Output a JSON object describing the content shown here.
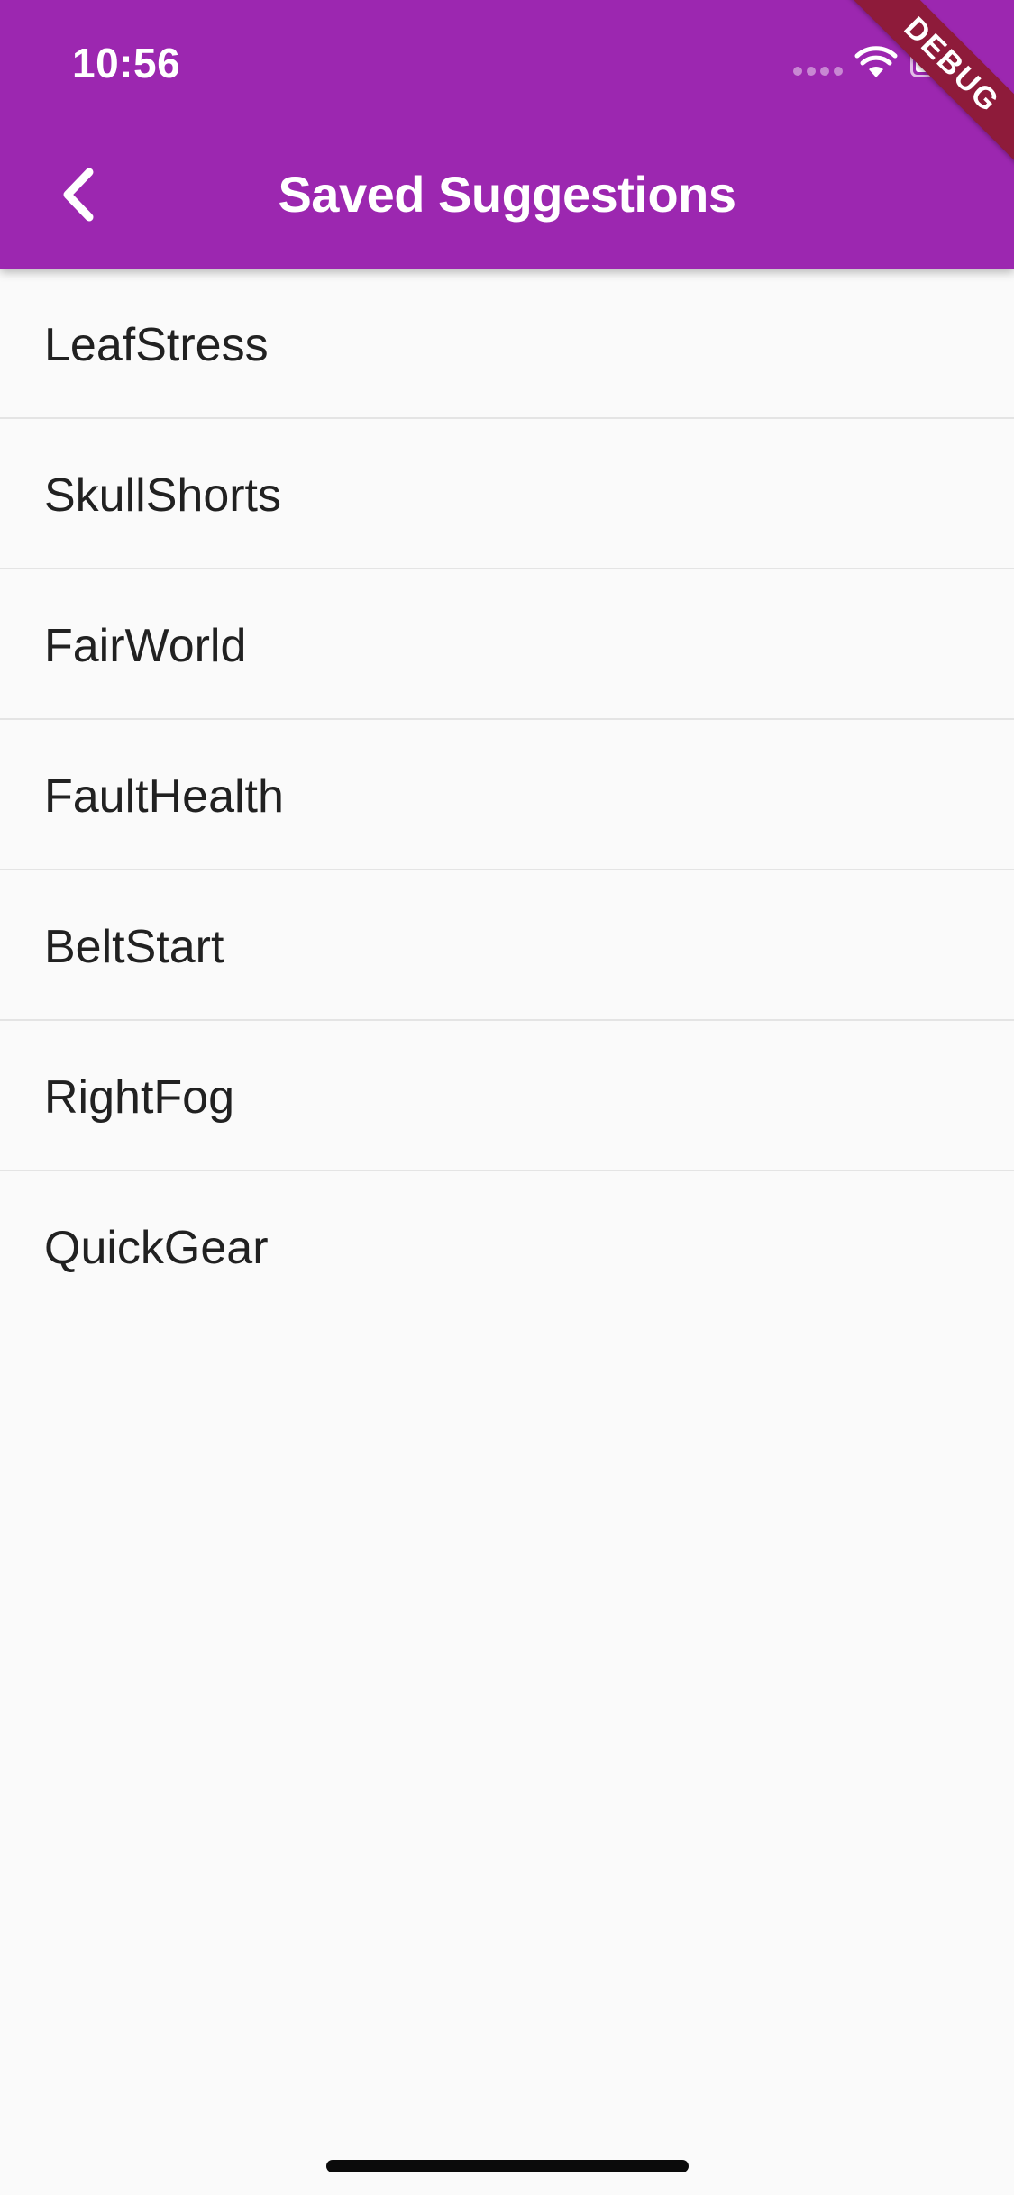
{
  "status_bar": {
    "time": "10:56"
  },
  "app_bar": {
    "title": "Saved Suggestions",
    "background": "#9c27b0",
    "back_icon": "chevron-left-icon"
  },
  "debug_banner": {
    "label": "DEBUG",
    "color": "#8e1b3a"
  },
  "saved_list": {
    "items": [
      {
        "label": "LeafStress"
      },
      {
        "label": "SkullShorts"
      },
      {
        "label": "FairWorld"
      },
      {
        "label": "FaultHealth"
      },
      {
        "label": "BeltStart"
      },
      {
        "label": "RightFog"
      },
      {
        "label": "QuickGear"
      }
    ]
  }
}
